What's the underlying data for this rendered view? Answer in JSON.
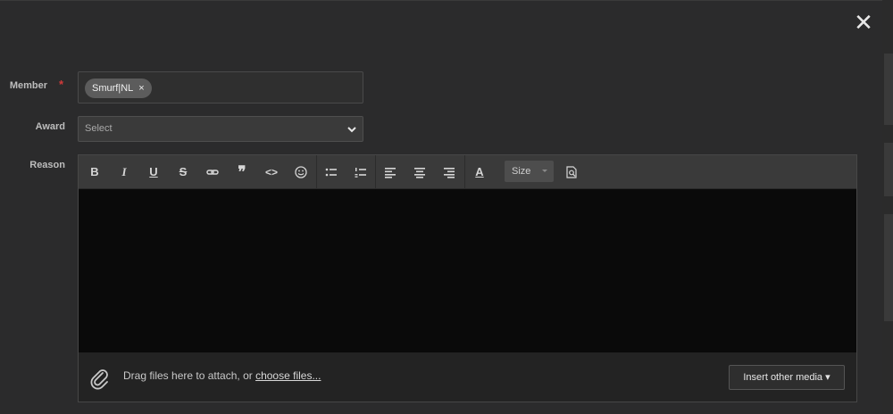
{
  "dialog": {
    "close_glyph": "✕"
  },
  "form": {
    "member": {
      "label": "Member",
      "required_mark": "*",
      "tokens": [
        {
          "text": "Smurf|NL",
          "remove_glyph": "×"
        }
      ]
    },
    "award": {
      "label": "Award",
      "value": "Select"
    },
    "reason": {
      "label": "Reason"
    }
  },
  "toolbar": {
    "buttons": [
      {
        "name": "bold",
        "glyph": "B"
      },
      {
        "name": "italic",
        "glyph": "I"
      },
      {
        "name": "underline",
        "glyph": "U"
      },
      {
        "name": "strikethrough",
        "glyph": "S"
      },
      {
        "name": "link",
        "icon": "link-icon"
      },
      {
        "name": "quote",
        "glyph": "❞"
      },
      {
        "name": "code",
        "glyph": "<>"
      },
      {
        "name": "emoji",
        "icon": "smile-icon"
      },
      {
        "name": "bullet-list",
        "icon": "bullet-list-icon"
      },
      {
        "name": "numbered-list",
        "icon": "numbered-list-icon"
      },
      {
        "name": "align-left",
        "icon": "align-left-icon"
      },
      {
        "name": "align-center",
        "icon": "align-center-icon"
      },
      {
        "name": "align-right",
        "icon": "align-right-icon"
      },
      {
        "name": "text-color",
        "glyph": "A"
      },
      {
        "name": "preview",
        "icon": "preview-icon"
      }
    ],
    "size_label": "Size"
  },
  "attach": {
    "text": "Drag files here to attach, or ",
    "link": "choose files..."
  },
  "insert_media": {
    "label": "Insert other media",
    "caret": "▾"
  },
  "colors": {
    "modal_bg": "#2b2b2c",
    "editor_bg": "#0a0a0a",
    "required": "#d23a3a"
  }
}
